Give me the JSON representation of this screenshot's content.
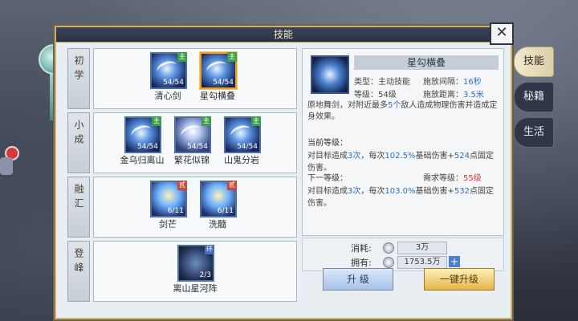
{
  "window": {
    "title": "技能",
    "close_glyph": "✕"
  },
  "tiers": [
    {
      "label": "初学",
      "skills": [
        {
          "name": "清心剑",
          "level": "54/54",
          "badge": "主",
          "selected": false
        },
        {
          "name": "星勾横叠",
          "level": "54/54",
          "badge": "主",
          "selected": true
        }
      ]
    },
    {
      "label": "小成",
      "skills": [
        {
          "name": "金乌归离山",
          "level": "54/54",
          "badge": "主"
        },
        {
          "name": "繁花似锦",
          "level": "54/54",
          "badge": "主"
        },
        {
          "name": "山鬼分岩",
          "level": "54/54",
          "badge": "主"
        }
      ]
    },
    {
      "label": "融汇",
      "skills": [
        {
          "name": "剑芒",
          "level": "6/11",
          "badge": "贰"
        },
        {
          "name": "洗髓",
          "level": "6/11",
          "badge": "贰"
        }
      ]
    },
    {
      "label": "登峰",
      "skills": [
        {
          "name": "离山星河阵",
          "level": "2/3",
          "badge": "环"
        }
      ]
    }
  ],
  "detail": {
    "name": "星勾横叠",
    "type_label": "类型：",
    "type_value": "主动技能",
    "interval_label": "施放间隔：",
    "interval_value": "16秒",
    "level_label": "等级：",
    "level_value": "54级",
    "distance_label": "施放距离：",
    "distance_value": "3.5米",
    "desc_a": "原地舞剑，对附近最多",
    "desc_count": "5个",
    "desc_b": "敌人造成物理伤害并造成定身效果。",
    "current_title": "当前等级：",
    "current_a": "对目标造成",
    "current_hits": "3次",
    "current_b": "，每次",
    "current_pct": "102.5%",
    "current_c": "基础伤害+",
    "current_flat": "524",
    "current_d": "点固定伤害。",
    "next_title": "下一等级：",
    "next_req_label": "需求等级：",
    "next_req_value": "55级",
    "next_a": "对目标造成",
    "next_hits": "3次",
    "next_b": "，每次",
    "next_pct": "103.0%",
    "next_c": "基础伤害+",
    "next_flat": "532",
    "next_d": "点固定伤害。"
  },
  "cost": {
    "consume_label": "消耗:",
    "consume_value": "3万",
    "own_label": "拥有:",
    "own_value": "1753.5万",
    "plus_glyph": "+"
  },
  "buttons": {
    "upgrade": "升 级",
    "one_click": "一键升级"
  },
  "right_tabs": [
    {
      "label": "技能",
      "active": true
    },
    {
      "label": "秘籍",
      "active": false
    },
    {
      "label": "生活",
      "active": false
    }
  ]
}
